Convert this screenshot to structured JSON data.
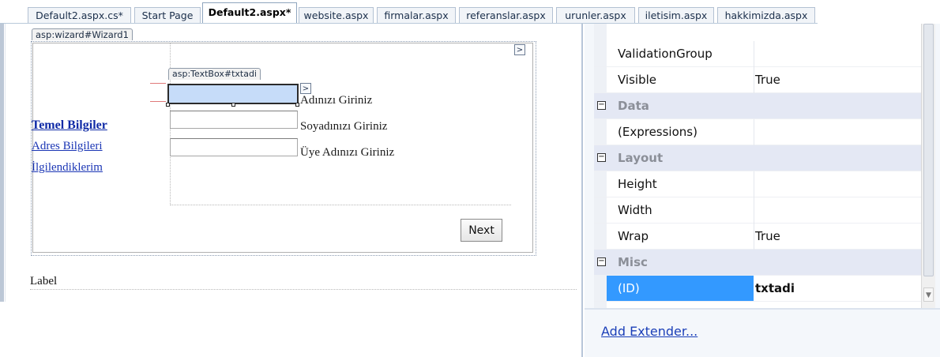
{
  "tabs": [
    {
      "label": "Default2.aspx.cs*"
    },
    {
      "label": "Start Page"
    },
    {
      "label": "Default2.aspx*"
    },
    {
      "label": "website.aspx"
    },
    {
      "label": "firmalar.aspx"
    },
    {
      "label": "referanslar.aspx"
    },
    {
      "label": "urunler.aspx"
    },
    {
      "label": "iletisim.aspx"
    },
    {
      "label": "hakkimizda.aspx"
    }
  ],
  "designer": {
    "wizard_tag": "asp:wizard#Wizard1",
    "textbox_tag": "asp:TextBox#txtadi",
    "smart_tag_glyph": ">",
    "sidebar": [
      {
        "label": "Temel Bilgiler"
      },
      {
        "label": "Adres Bilgileri"
      },
      {
        "label": "İlgilendiklerim"
      }
    ],
    "fields": [
      {
        "label": "Adınızı Giriniz",
        "value": ""
      },
      {
        "label": "Soyadınızı Giriniz",
        "value": ""
      },
      {
        "label": "Üye Adınızı Giriniz",
        "value": ""
      }
    ],
    "next_button": "Next",
    "label_control": "Label"
  },
  "properties": {
    "rows": [
      {
        "name": "ValidationGroup",
        "value": ""
      },
      {
        "name": "Visible",
        "value": "True"
      },
      {
        "category": "Data",
        "toggle": "⊟"
      },
      {
        "name": "(Expressions)",
        "value": ""
      },
      {
        "category": "Layout",
        "toggle": "⊟"
      },
      {
        "name": "Height",
        "value": ""
      },
      {
        "name": "Width",
        "value": ""
      },
      {
        "name": "Wrap",
        "value": "True"
      },
      {
        "category": "Misc",
        "toggle": "⊟"
      },
      {
        "name": "(ID)",
        "value": "txtadi",
        "selected": true
      }
    ],
    "add_extender": "Add Extender..."
  },
  "colors": {
    "selection": "#3399ff",
    "link": "#1b36b5",
    "selected_textbox": "#c6dcf9"
  }
}
